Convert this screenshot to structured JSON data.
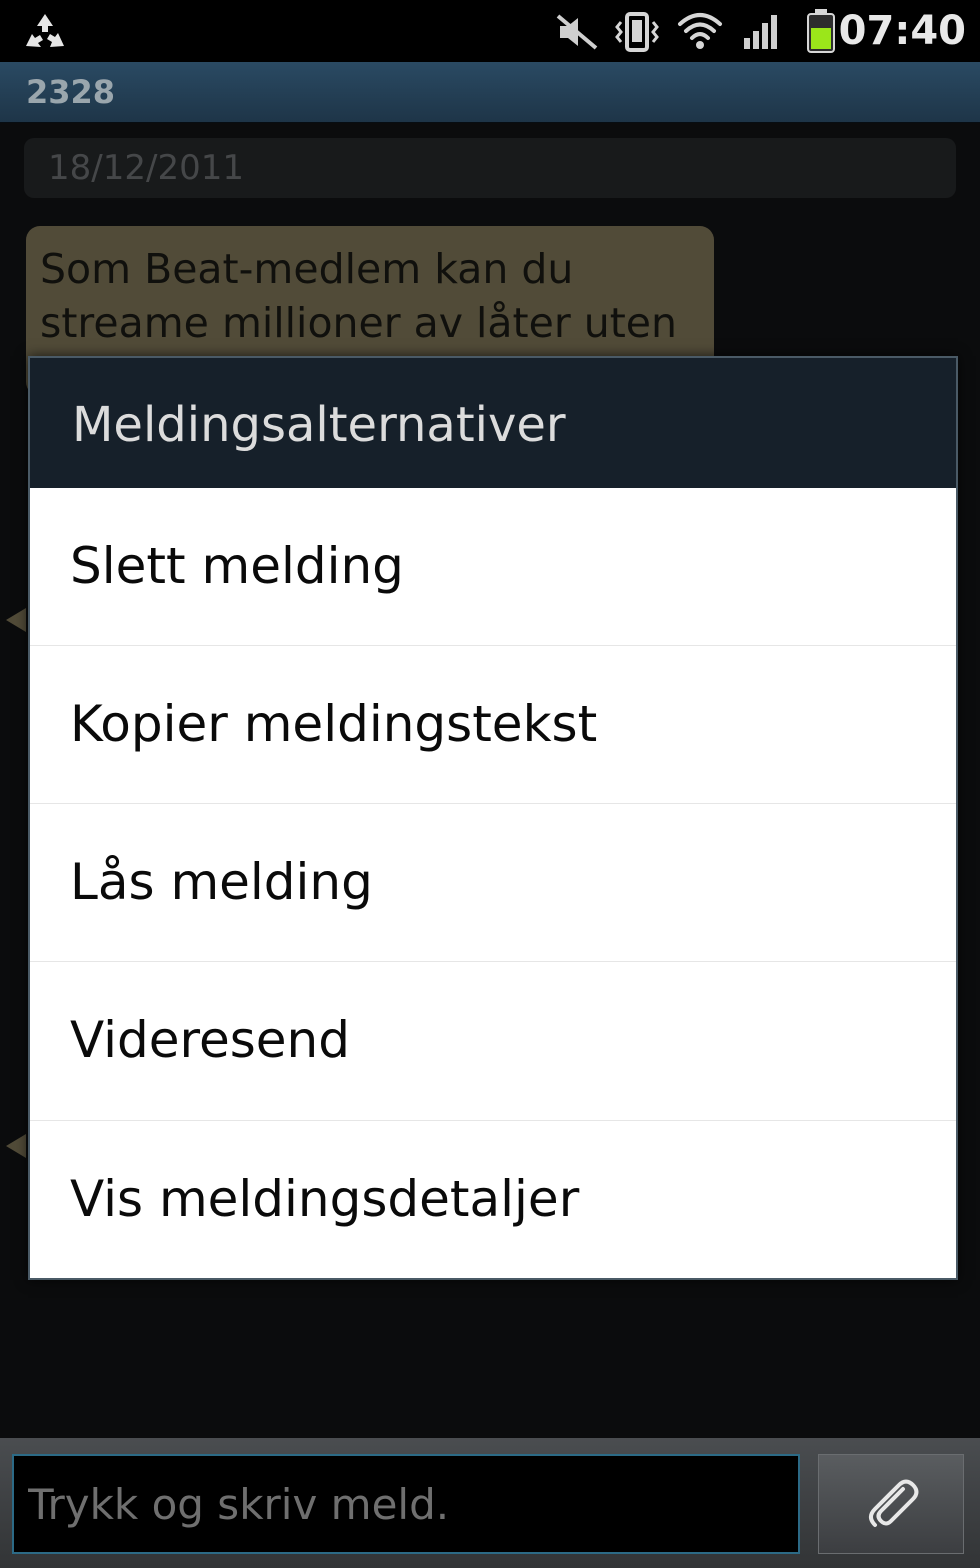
{
  "status_bar": {
    "time": "07:40",
    "icons": [
      "recycle-icon",
      "mute-icon",
      "vibrate-icon",
      "wifi-icon",
      "signal-icon",
      "battery-icon"
    ]
  },
  "conversation": {
    "title": "2328",
    "date": "18/12/2011",
    "message_text": "Som Beat-medlem kan du streame millioner av låter uten"
  },
  "dialog": {
    "title": "Meldingsalternativer",
    "items": [
      {
        "label": "Slett melding"
      },
      {
        "label": "Kopier meldingstekst"
      },
      {
        "label": "Lås melding"
      },
      {
        "label": "Videresend"
      },
      {
        "label": "Vis meldingsdetaljer"
      }
    ]
  },
  "composer": {
    "placeholder": "Trykk og skriv meld.",
    "attach_icon": "paperclip-icon"
  },
  "colors": {
    "bubble": "#7d7356",
    "dialog_header": "#16202a",
    "header_bar": "#1e3548",
    "battery_fill": "#9be61a"
  }
}
